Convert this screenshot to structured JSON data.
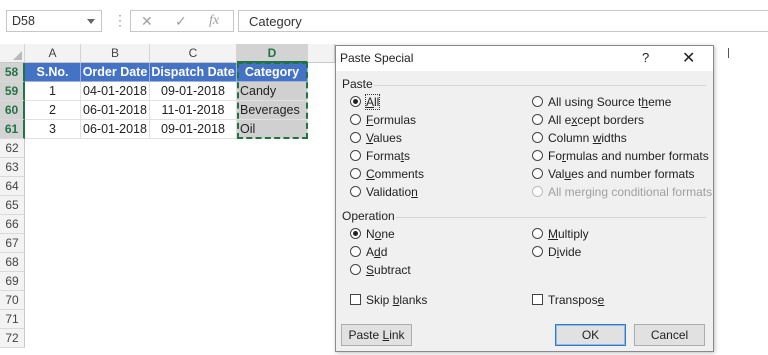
{
  "formula_bar": {
    "name_box": "D58",
    "cancel_icon": "✕",
    "enter_icon": "✓",
    "fx_icon": "fx",
    "formula_value": "Category"
  },
  "columns": [
    "A",
    "B",
    "C",
    "D"
  ],
  "rows": [
    "58",
    "59",
    "60",
    "61",
    "62",
    "63",
    "64",
    "65",
    "66",
    "67",
    "68",
    "69",
    "70",
    "71",
    "72"
  ],
  "table": {
    "headers": [
      "S.No.",
      "Order Date",
      "Dispatch Date",
      "Category"
    ],
    "data": [
      [
        "1",
        "04-01-2018",
        "09-01-2018",
        "Candy"
      ],
      [
        "2",
        "06-01-2018",
        "11-01-2018",
        "Beverages"
      ],
      [
        "3",
        "06-01-2018",
        "09-01-2018",
        "Oil"
      ]
    ]
  },
  "dialog": {
    "title": "Paste Special",
    "help": "?",
    "close": "✕",
    "paste_group": "Paste",
    "paste_left": [
      {
        "pre": "",
        "key": "A",
        "post": "ll",
        "selected": true
      },
      {
        "pre": "",
        "key": "F",
        "post": "ormulas",
        "selected": false
      },
      {
        "pre": "",
        "key": "V",
        "post": "alues",
        "selected": false
      },
      {
        "pre": "Forma",
        "key": "t",
        "post": "s",
        "selected": false
      },
      {
        "pre": "",
        "key": "C",
        "post": "omments",
        "selected": false
      },
      {
        "pre": "Validatio",
        "key": "n",
        "post": "",
        "selected": false
      }
    ],
    "paste_right": [
      {
        "pre": "All using Source t",
        "key": "h",
        "post": "eme",
        "disabled": false
      },
      {
        "pre": "All e",
        "key": "x",
        "post": "cept borders",
        "disabled": false
      },
      {
        "pre": "Column ",
        "key": "w",
        "post": "idths",
        "disabled": false
      },
      {
        "pre": "Fo",
        "key": "r",
        "post": "mulas and number formats",
        "disabled": false
      },
      {
        "pre": "Val",
        "key": "u",
        "post": "es and number formats",
        "disabled": false
      },
      {
        "pre": "All merging conditional formats",
        "key": "",
        "post": "",
        "disabled": true
      }
    ],
    "operation_group": "Operation",
    "op_left": [
      {
        "pre": "N",
        "key": "o",
        "post": "ne",
        "selected": true
      },
      {
        "pre": "A",
        "key": "d",
        "post": "d",
        "selected": false
      },
      {
        "pre": "",
        "key": "S",
        "post": "ubtract",
        "selected": false
      }
    ],
    "op_right": [
      {
        "pre": "",
        "key": "M",
        "post": "ultiply",
        "selected": false
      },
      {
        "pre": "D",
        "key": "i",
        "post": "vide",
        "selected": false
      }
    ],
    "skip_blanks": {
      "pre": "Skip ",
      "key": "b",
      "post": "lanks"
    },
    "transpose": {
      "pre": "Transpos",
      "key": "e",
      "post": ""
    },
    "paste_link": {
      "pre": "Paste ",
      "key": "L",
      "post": "ink"
    },
    "ok": "OK",
    "cancel": "Cancel"
  }
}
